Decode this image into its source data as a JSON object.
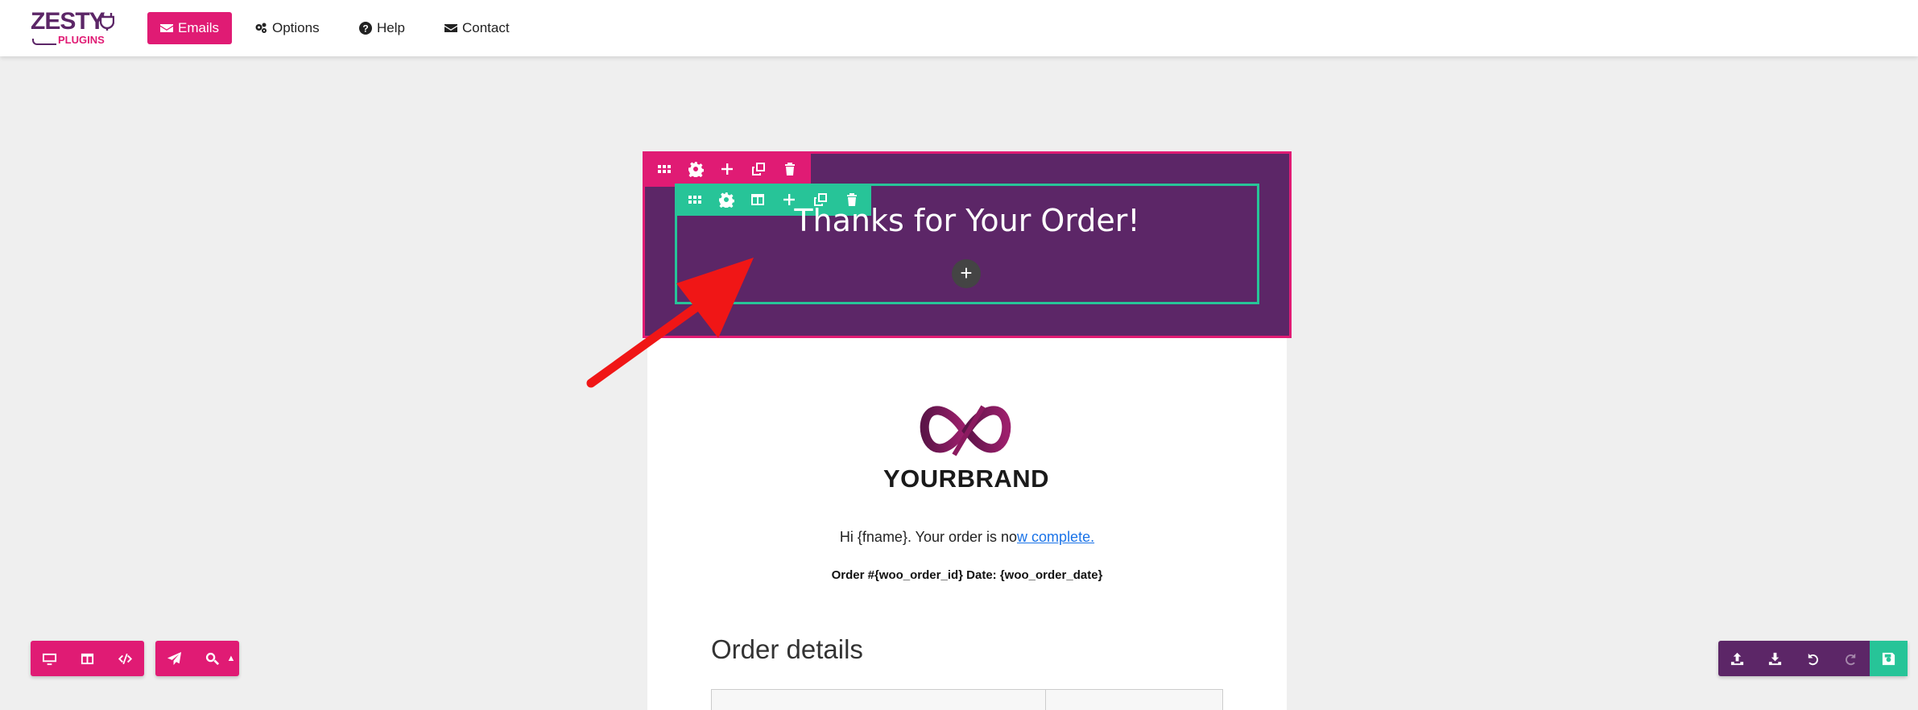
{
  "app": {
    "logo_top": "ZESTY",
    "logo_bottom": "PLUGINS"
  },
  "nav": {
    "items": [
      {
        "label": "Emails",
        "icon": "envelope-icon",
        "active": true
      },
      {
        "label": "Options",
        "icon": "gears-icon",
        "active": false
      },
      {
        "label": "Help",
        "icon": "question-circle-icon",
        "active": false
      },
      {
        "label": "Contact",
        "icon": "envelope-icon",
        "active": false
      }
    ]
  },
  "editor": {
    "row_toolbar_icons": [
      "grid-icon",
      "gear-icon",
      "plus-icon",
      "copy-icon",
      "trash-icon"
    ],
    "column_toolbar_icons": [
      "grid-icon",
      "gear-icon",
      "columns-icon",
      "plus-icon",
      "copy-icon",
      "trash-icon"
    ],
    "add_block_label": "+"
  },
  "email": {
    "header_title": "Thanks for Your Order!",
    "brand_name": "YOURBRAND",
    "greeting_prefix": "Hi {fname}.  Your order is no",
    "greeting_link": "w complete.",
    "order_line": "Order #{woo_order_id} Date: {woo_order_date}",
    "section_title": "Order details"
  },
  "bottom_left_toolbar": {
    "group1": [
      "desktop-icon",
      "columns-icon",
      "code-icon"
    ],
    "group2": [
      "paper-plane-icon",
      "search-icon",
      "caret-up-icon"
    ]
  },
  "bottom_right_toolbar": [
    "upload-icon",
    "download-icon",
    "undo-icon",
    "redo-icon",
    "save-icon"
  ],
  "colors": {
    "brand_pink": "#e01b74",
    "brand_purple": "#5c2667",
    "accent_green": "#27c498",
    "annotation_red": "#f01616"
  }
}
